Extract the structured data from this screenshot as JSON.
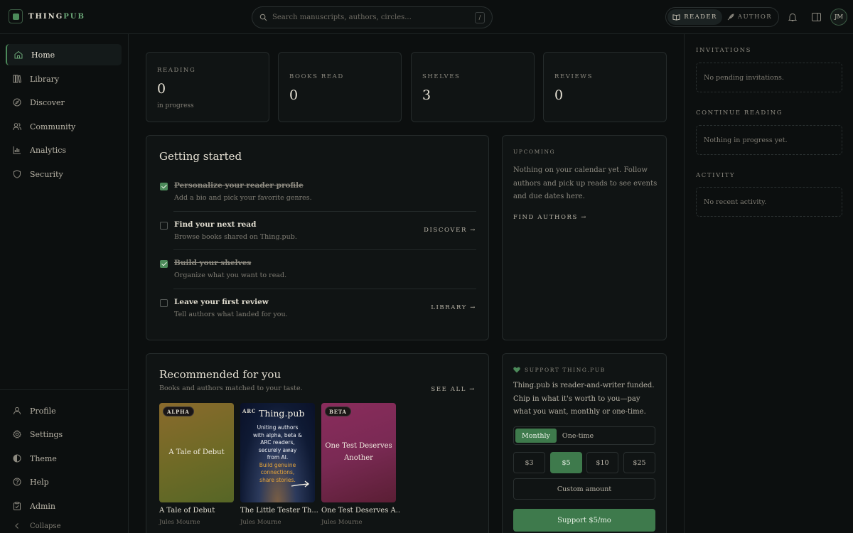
{
  "brand": {
    "name_main": "THING",
    "name_accent": "PUB"
  },
  "search": {
    "placeholder": "Search manuscripts, authors, circles...",
    "shortcut": "/"
  },
  "modes": [
    {
      "label": "READER",
      "active": true
    },
    {
      "label": "AUTHOR",
      "active": false
    }
  ],
  "user": {
    "initials": "JM"
  },
  "sidebar": {
    "items": [
      {
        "label": "Home",
        "icon": "home-icon",
        "active": true
      },
      {
        "label": "Library",
        "icon": "library-icon"
      },
      {
        "label": "Discover",
        "icon": "compass-icon"
      },
      {
        "label": "Community",
        "icon": "users-icon"
      },
      {
        "label": "Analytics",
        "icon": "chart-icon"
      },
      {
        "label": "Security",
        "icon": "shield-icon"
      }
    ],
    "bottom_items": [
      {
        "label": "Profile",
        "icon": "user-icon"
      },
      {
        "label": "Settings",
        "icon": "gear-icon"
      },
      {
        "label": "Theme",
        "icon": "theme-icon"
      },
      {
        "label": "Help",
        "icon": "help-icon"
      },
      {
        "label": "Admin",
        "icon": "clipboard-icon"
      },
      {
        "label": "Collapse",
        "icon": "chevron-left-icon"
      }
    ]
  },
  "stats": [
    {
      "label": "READING",
      "value": "0",
      "sub": "in progress"
    },
    {
      "label": "BOOKS READ",
      "value": "0"
    },
    {
      "label": "SHELVES",
      "value": "3"
    },
    {
      "label": "REVIEWS",
      "value": "0"
    }
  ],
  "getting_started": {
    "title": "Getting started",
    "tasks": [
      {
        "title": "Personalize your reader profile",
        "desc": "Add a bio and pick your favorite genres.",
        "done": true,
        "link": ""
      },
      {
        "title": "Find your next read",
        "desc": "Browse books shared on Thing.pub.",
        "done": false,
        "link": "DISCOVER →"
      },
      {
        "title": "Build your shelves",
        "desc": "Organize what you want to read.",
        "done": true,
        "link": ""
      },
      {
        "title": "Leave your first review",
        "desc": "Tell authors what landed for you.",
        "done": false,
        "link": "LIBRARY →"
      }
    ]
  },
  "upcoming": {
    "label": "UPCOMING",
    "text": "Nothing on your calendar yet. Follow authors and pick up reads to see events and due dates here.",
    "link": "FIND AUTHORS →"
  },
  "recommended": {
    "title": "Recommended for you",
    "subtitle": "Books and authors matched to your taste.",
    "see_all": "SEE ALL →",
    "books": [
      {
        "badge": "ALPHA",
        "cover_title": "A Tale of Debut",
        "title": "A Tale of Debut",
        "author": "Jules Mourne"
      },
      {
        "badge": "ARC",
        "cover_brand": "Thing.pub",
        "cover_text": [
          "Uniting authors",
          "with alpha, beta &",
          "ARC readers,",
          "securely away",
          "from AI."
        ],
        "cover_highlight": [
          "Build genuine",
          "connections,",
          "share stories."
        ],
        "title": "The Little Tester Th...",
        "author": "Jules Mourne"
      },
      {
        "badge": "BETA",
        "cover_title_lines": [
          "One Test Deserves",
          "Another"
        ],
        "title": "One Test Deserves A...",
        "author": "Jules Mourne"
      }
    ]
  },
  "support": {
    "label": "SUPPORT THING.PUB",
    "text": "Thing.pub is reader-and-writer funded. Chip in what it's worth to you—pay what you want, monthly or one-time.",
    "frequencies": [
      {
        "label": "Monthly",
        "active": true
      },
      {
        "label": "One-time",
        "active": false
      }
    ],
    "amounts": [
      {
        "label": "$3"
      },
      {
        "label": "$5",
        "active": true
      },
      {
        "label": "$10"
      },
      {
        "label": "$25"
      }
    ],
    "custom_label": "Custom amount",
    "button_label": "Support $5/mo"
  },
  "rail": {
    "invitations": {
      "title": "INVITATIONS",
      "empty": "No pending invitations."
    },
    "continue": {
      "title": "CONTINUE READING",
      "empty": "Nothing in progress yet."
    },
    "activity": {
      "title": "ACTIVITY",
      "empty": "No recent activity."
    }
  },
  "colors": {
    "accent": "#4c8a5a",
    "background": "#0c0f0f",
    "card": "#101414"
  }
}
